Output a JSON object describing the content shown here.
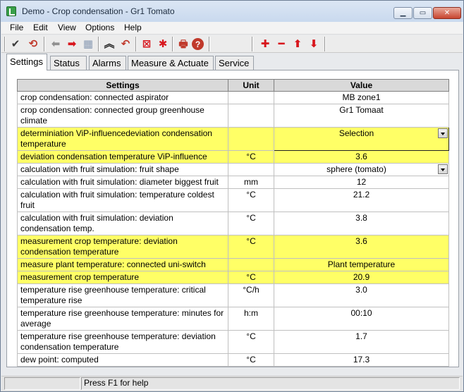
{
  "window": {
    "title": "Demo - Crop condensation - Gr1 Tomato"
  },
  "menu": [
    "File",
    "Edit",
    "View",
    "Options",
    "Help"
  ],
  "toolbar": {
    "buttons": [
      {
        "name": "check-icon",
        "glyph": "✔",
        "color": "#3c3c3c"
      },
      {
        "name": "refresh-icon",
        "glyph": "⟲",
        "color": "#c0392b"
      },
      {
        "name": "arrow-left-icon",
        "glyph": "⬅",
        "color": "#909090"
      },
      {
        "name": "arrow-right-icon",
        "glyph": "➡",
        "color": "#d8161d"
      },
      {
        "name": "grid-icon",
        "glyph": "▦",
        "color": "#8a9bb4"
      },
      {
        "name": "collapse-icon",
        "glyph": "︽",
        "color": "#222222"
      },
      {
        "name": "undo-icon",
        "glyph": "↶",
        "color": "#c0392b"
      },
      {
        "name": "delete-box-icon",
        "glyph": "⊠",
        "color": "#d8161d"
      },
      {
        "name": "asterisk-icon",
        "glyph": "✱",
        "color": "#d8161d"
      },
      {
        "name": "print-icon",
        "glyph": "🖶",
        "color": "#c0392b"
      },
      {
        "name": "help-icon",
        "glyph": "?",
        "color": "#ffffff"
      },
      {
        "name": "add-icon",
        "glyph": "✚",
        "color": "#d8161d"
      },
      {
        "name": "remove-icon",
        "glyph": "━",
        "color": "#d8161d"
      },
      {
        "name": "move-up-icon",
        "glyph": "⬆",
        "color": "#d8161d"
      },
      {
        "name": "move-down-icon",
        "glyph": "⬇",
        "color": "#d8161d"
      }
    ]
  },
  "tabs": [
    {
      "label": "Settings",
      "active": true
    },
    {
      "label": "Status",
      "active": false
    },
    {
      "label": "Alarms",
      "active": false
    },
    {
      "label": "Measure & Actuate",
      "active": false
    },
    {
      "label": "Service",
      "active": false
    }
  ],
  "table": {
    "headers": {
      "settings": "Settings",
      "unit": "Unit",
      "value": "Value"
    },
    "rows": [
      {
        "setting": "crop condensation: connected aspirator",
        "unit": "",
        "value": "MB zone1",
        "highlight": false,
        "dropdown": false
      },
      {
        "setting": "crop condensation: connected group greenhouse climate",
        "unit": "",
        "value": "Gr1 Tomaat",
        "highlight": false,
        "dropdown": false
      },
      {
        "setting": "determiniation ViP-influencedeviation condensation temperature",
        "unit": "",
        "value": "Selection",
        "highlight": true,
        "dropdown": true,
        "selected": true
      },
      {
        "setting": "deviation condensation temperature ViP-influence",
        "unit": "°C",
        "value": "3.6",
        "highlight": true,
        "dropdown": false
      },
      {
        "setting": "calculation with fruit simulation: fruit shape",
        "unit": "",
        "value": "sphere (tomato)",
        "highlight": false,
        "dropdown": true
      },
      {
        "setting": "calculation with fruit simulation: diameter biggest fruit",
        "unit": "mm",
        "value": "12",
        "highlight": false,
        "dropdown": false
      },
      {
        "setting": "calculation with fruit simulation: temperature coldest fruit",
        "unit": "°C",
        "value": "21.2",
        "highlight": false,
        "dropdown": false
      },
      {
        "setting": "calculation with fruit simulation: deviation condensation temp.",
        "unit": "°C",
        "value": "3.8",
        "highlight": false,
        "dropdown": false
      },
      {
        "setting": "measurement crop temperature: deviation condensation temperature",
        "unit": "°C",
        "value": "3.6",
        "highlight": true,
        "dropdown": false
      },
      {
        "setting": "measure plant temperature: connected uni-switch",
        "unit": "",
        "value": "Plant temperature",
        "highlight": true,
        "dropdown": false
      },
      {
        "setting": "measurement crop temperature",
        "unit": "°C",
        "value": "20.9",
        "highlight": true,
        "dropdown": false
      },
      {
        "setting": "temperature rise greenhouse temperature: critical temperature rise",
        "unit": "°C/h",
        "value": "3.0",
        "highlight": false,
        "dropdown": false
      },
      {
        "setting": "temperature rise greenhouse temperature: minutes for average",
        "unit": "h:m",
        "value": "00:10",
        "highlight": false,
        "dropdown": false
      },
      {
        "setting": "temperature rise greenhouse temperature: deviation condensation temperature",
        "unit": "°C",
        "value": "1.7",
        "highlight": false,
        "dropdown": false
      },
      {
        "setting": "dew point: computed",
        "unit": "°C",
        "value": "17.3",
        "highlight": false,
        "dropdown": false
      }
    ]
  },
  "status": {
    "text": "Press F1 for help"
  },
  "colors": {
    "highlight": "#ffff66",
    "header": "#d9d9d9"
  }
}
